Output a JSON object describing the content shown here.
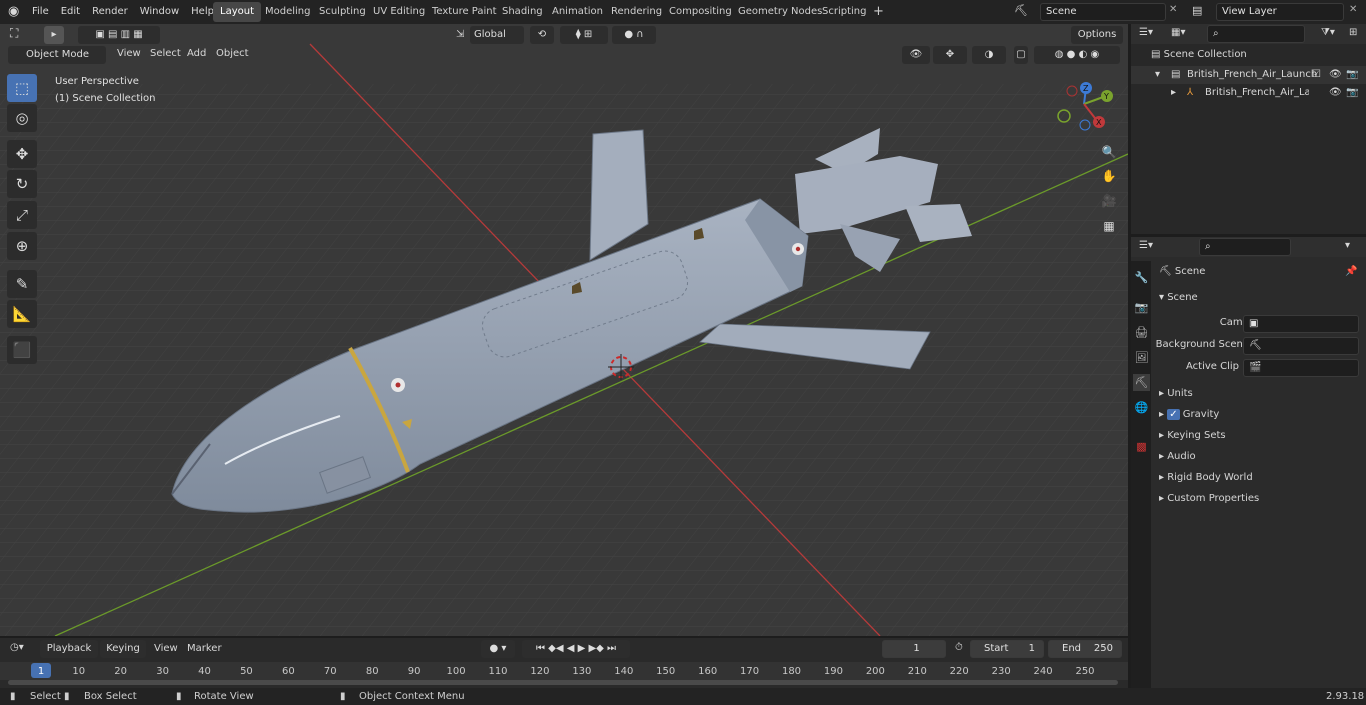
{
  "topbar": {
    "menu": [
      "File",
      "Edit",
      "Render",
      "Window",
      "Help"
    ],
    "workspaces": [
      "Layout",
      "Modeling",
      "Sculpting",
      "UV Editing",
      "Texture Paint",
      "Shading",
      "Animation",
      "Rendering",
      "Compositing",
      "Geometry Nodes",
      "Scripting"
    ],
    "active_workspace": "Layout",
    "add_tab": "+",
    "scene_name": "Scene",
    "view_layer": "View Layer"
  },
  "viewport": {
    "mode": "Object Mode",
    "menus": [
      "View",
      "Select",
      "Add",
      "Object"
    ],
    "orientation": "Global",
    "options": "Options",
    "overlay_title": "User Perspective",
    "overlay_collection": "(1) Scene Collection",
    "gizmo_axes": [
      "X",
      "Y",
      "Z"
    ]
  },
  "outliner": {
    "root": "Scene Collection",
    "items": [
      {
        "label": "British_French_Air_Launched_"
      },
      {
        "label": "British_French_Air_Launc"
      }
    ]
  },
  "properties": {
    "context": "Scene",
    "section": "Scene",
    "fields": [
      {
        "label": "Camera"
      },
      {
        "label": "Background Scene"
      },
      {
        "label": "Active Clip"
      }
    ],
    "panels": [
      "Units",
      "Gravity",
      "Keying Sets",
      "Audio",
      "Rigid Body World",
      "Custom Properties"
    ]
  },
  "timeline": {
    "menus": [
      "Playback",
      "Keying",
      "View",
      "Marker"
    ],
    "current_frame": "1",
    "start_label": "Start",
    "start": "1",
    "end_label": "End",
    "end": "250",
    "ticks": [
      "1",
      "10",
      "20",
      "30",
      "40",
      "50",
      "60",
      "70",
      "80",
      "90",
      "100",
      "110",
      "120",
      "130",
      "140",
      "150",
      "160",
      "170",
      "180",
      "190",
      "200",
      "210",
      "220",
      "230",
      "240",
      "250"
    ]
  },
  "statusbar": {
    "items": [
      "Select",
      "Box Select",
      "Rotate View",
      "Object Context Menu"
    ],
    "version": "2.93.18"
  },
  "colors": {
    "accent": "#4772b3",
    "x_axis": "#c0393b",
    "y_axis": "#7aa32d",
    "z_axis": "#3d7bd7",
    "missile_body": "#9aa6b6"
  }
}
